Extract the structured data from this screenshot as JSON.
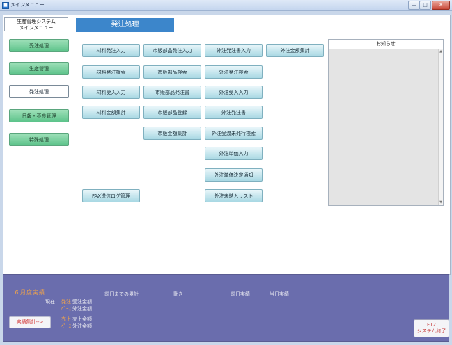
{
  "window": {
    "title": "メインメニュー",
    "min": "—",
    "max": "□",
    "close": "✕"
  },
  "sidebar": {
    "system_title_1": "生産管理システム",
    "system_title_2": "メインメニュー",
    "items": [
      {
        "label": "受注処理"
      },
      {
        "label": "生産管理"
      },
      {
        "label": "発注処理",
        "active": true
      },
      {
        "label": "日報・不良管理"
      },
      {
        "label": "特殊処理"
      }
    ]
  },
  "page_title": "発注処理",
  "buttons": {
    "col1": [
      "材料発注入力",
      "材料発注検索",
      "材料受入入力",
      "材料金額集計",
      "FAX送信ログ管理"
    ],
    "col2": [
      "市販部品発注入力",
      "市販部品検索",
      "市販部品発注書",
      "市販部品登録",
      "市販金額集計"
    ],
    "col3": [
      "外注発注書入力",
      "外注発注検索",
      "外注受入入力",
      "外注発注書",
      "外注受渡未発行検索",
      "外注単価入力",
      "外注単価決定通知",
      "外注未納入リスト"
    ],
    "col4": [
      "外注金額集計"
    ]
  },
  "notice": {
    "title": "お知らせ",
    "scroll_up": "▲",
    "scroll_down": "▼"
  },
  "bottom": {
    "month_label": "６月度実績",
    "current_label": "現在",
    "row1_tag": "発注",
    "row1_text": "受注金額",
    "row2_tag": "ﾍﾟｰｽ",
    "row2_text": "外注金額",
    "prev_total": "前日までの累計",
    "movement": "動き",
    "prev_day": "前日実績",
    "today": "当日実績",
    "row3_tag": "売上",
    "row3_text": "売上金額",
    "row4_tag": "ﾍﾟｰｽ",
    "row4_text": "外注金額",
    "result_button": "実績集計-->",
    "f12_key": "F12",
    "f12_label": "システム終了"
  }
}
